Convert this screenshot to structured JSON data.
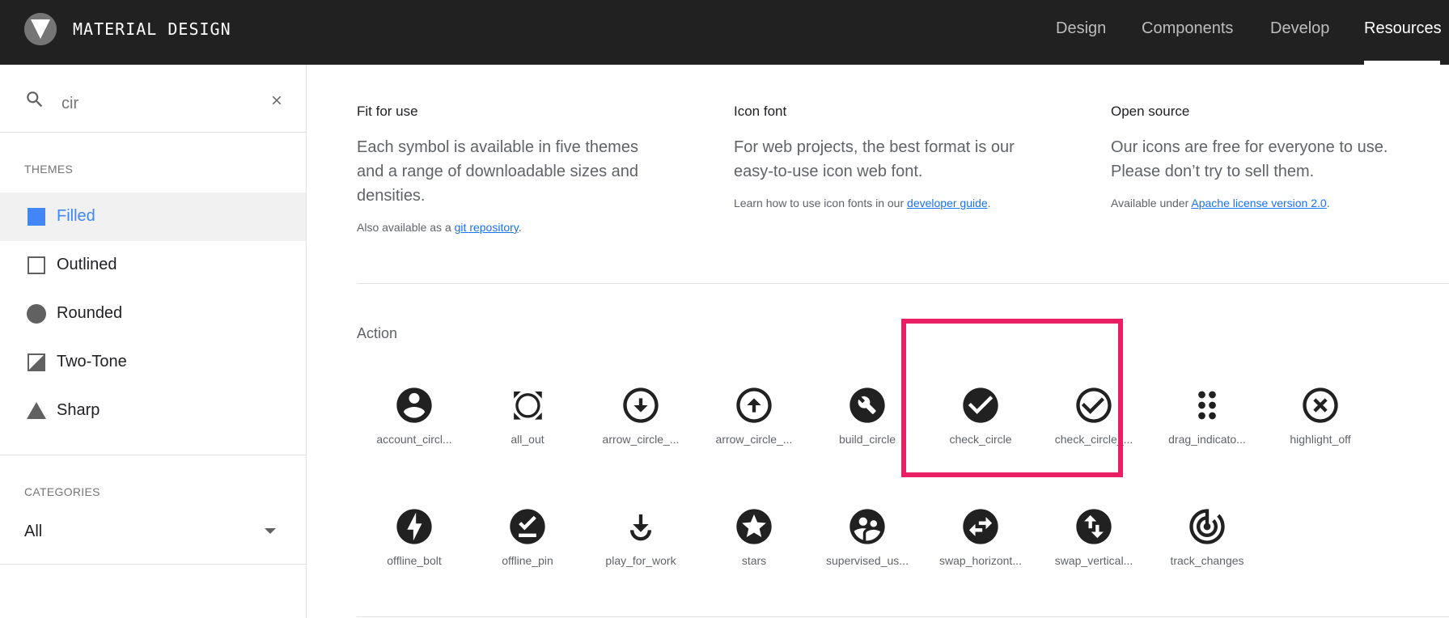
{
  "header": {
    "brand": "MATERIAL DESIGN",
    "nav": [
      {
        "label": "Design",
        "active": false
      },
      {
        "label": "Components",
        "active": false
      },
      {
        "label": "Develop",
        "active": false
      },
      {
        "label": "Resources",
        "active": true
      }
    ]
  },
  "sidebar": {
    "search": {
      "value": "cir"
    },
    "themes_label": "THEMES",
    "themes": [
      {
        "label": "Filled",
        "icon": "filled-square-icon",
        "active": true
      },
      {
        "label": "Outlined",
        "icon": "outlined-square-icon",
        "active": false
      },
      {
        "label": "Rounded",
        "icon": "circle-icon",
        "active": false
      },
      {
        "label": "Two-Tone",
        "icon": "two-tone-icon",
        "active": false
      },
      {
        "label": "Sharp",
        "icon": "triangle-icon",
        "active": false
      }
    ],
    "categories_label": "CATEGORIES",
    "category_value": "All"
  },
  "features": [
    {
      "title": "Fit for use",
      "desc": "Each symbol is available in five themes and a range of downloadable sizes and densities.",
      "note_prefix": "Also available as a ",
      "note_link": "git repository",
      "note_suffix": "."
    },
    {
      "title": "Icon font",
      "desc": "For web projects, the best format is our easy-to-use icon web font.",
      "note_prefix": "Learn how to use icon fonts in our ",
      "note_link": "developer guide",
      "note_suffix": "."
    },
    {
      "title": "Open source",
      "desc": "Our icons are free for everyone to use. Please don’t try to sell them.",
      "note_prefix": "Available under ",
      "note_link": "Apache license version 2.0",
      "note_suffix": "."
    }
  ],
  "section": {
    "title": "Action"
  },
  "icons": [
    {
      "label": "account_circl...",
      "icon": "account-circle-icon"
    },
    {
      "label": "all_out",
      "icon": "all-out-icon"
    },
    {
      "label": "arrow_circle_...",
      "icon": "arrow-circle-down-icon"
    },
    {
      "label": "arrow_circle_...",
      "icon": "arrow-circle-up-icon"
    },
    {
      "label": "build_circle",
      "icon": "build-circle-icon"
    },
    {
      "label": "check_circle",
      "icon": "check-circle-icon"
    },
    {
      "label": "check_circle_...",
      "icon": "check-circle-outline-icon"
    },
    {
      "label": "drag_indicato...",
      "icon": "drag-indicator-icon"
    },
    {
      "label": "highlight_off",
      "icon": "highlight-off-icon"
    },
    {
      "label": "offline_bolt",
      "icon": "offline-bolt-icon"
    },
    {
      "label": "offline_pin",
      "icon": "offline-pin-icon"
    },
    {
      "label": "play_for_work",
      "icon": "play-for-work-icon"
    },
    {
      "label": "stars",
      "icon": "stars-icon"
    },
    {
      "label": "supervised_us...",
      "icon": "supervised-user-circle-icon"
    },
    {
      "label": "swap_horizont...",
      "icon": "swap-horizontal-circle-icon"
    },
    {
      "label": "swap_vertical...",
      "icon": "swap-vertical-circle-icon"
    },
    {
      "label": "track_changes",
      "icon": "track-changes-icon"
    }
  ],
  "colors": {
    "accent": "#4285f4",
    "highlight": "#e91e63",
    "topbar": "#212121"
  }
}
